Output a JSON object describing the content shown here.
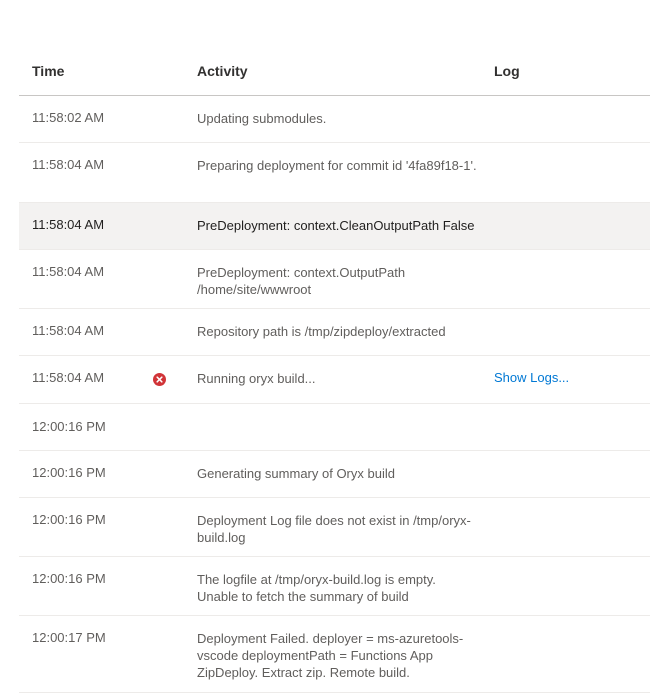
{
  "header": {
    "time": "Time",
    "activity": "Activity",
    "log": "Log"
  },
  "rows": [
    {
      "time": "11:58:02 AM",
      "activity": "Updating submodules.",
      "log": ""
    },
    {
      "time": "11:58:04 AM",
      "activity": "Preparing deployment for commit id '4fa89f18-1'.",
      "log": ""
    },
    {
      "time": "11:58:04 AM",
      "activity": "PreDeployment: context.CleanOutputPath False",
      "log": ""
    },
    {
      "time": "11:58:04 AM",
      "activity": "PreDeployment: context.OutputPath /home/site/wwwroot",
      "log": ""
    },
    {
      "time": "11:58:04 AM",
      "activity": "Repository path is /tmp/zipdeploy/extracted",
      "log": ""
    },
    {
      "time": "11:58:04 AM",
      "activity": "Running oryx build...",
      "log": "Show Logs...",
      "status_icon": "error-icon"
    },
    {
      "time": "12:00:16 PM",
      "activity": "",
      "log": ""
    },
    {
      "time": "12:00:16 PM",
      "activity": "Generating summary of Oryx build",
      "log": ""
    },
    {
      "time": "12:00:16 PM",
      "activity": "Deployment Log file does not exist in /tmp/oryx-build.log",
      "log": ""
    },
    {
      "time": "12:00:16 PM",
      "activity": "The logfile at /tmp/oryx-build.log is empty. Unable to fetch the summary of build",
      "log": ""
    },
    {
      "time": "12:00:17 PM",
      "activity": "Deployment Failed. deployer = ms-azuretools-vscode deploymentPath = Functions App ZipDeploy. Extract zip. Remote build.",
      "log": ""
    }
  ],
  "colors": {
    "error": "#d13438",
    "link": "#0078d4",
    "selected_row": "#f3f2f1"
  }
}
